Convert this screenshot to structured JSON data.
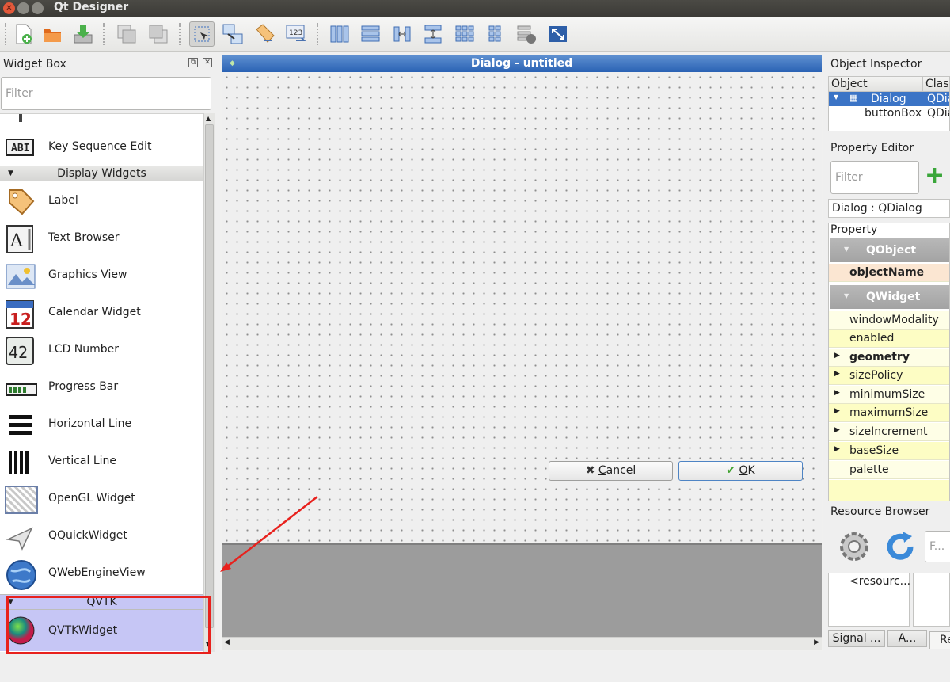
{
  "window": {
    "title": "Qt Designer"
  },
  "toolbar": {
    "icons": [
      "new-form",
      "open-form",
      "save-form",
      "send-to-back",
      "bring-to-front",
      "edit-widgets",
      "edit-signals-slots",
      "edit-buddies",
      "edit-tab-order",
      "layout-horizontal",
      "layout-vertical",
      "layout-splitter-h",
      "layout-splitter-v",
      "layout-grid",
      "layout-form",
      "break-layout",
      "adjust-size"
    ],
    "active": "edit-widgets"
  },
  "widget_box": {
    "title": "Widget Box",
    "filter_placeholder": "Filter",
    "items_top": [
      {
        "label": "Key Sequence Edit",
        "icon": "key-sequence-edit-icon"
      }
    ],
    "categories": [
      {
        "label": "Display Widgets",
        "items": [
          {
            "label": "Label",
            "icon": "label-icon"
          },
          {
            "label": "Text Browser",
            "icon": "text-browser-icon"
          },
          {
            "label": "Graphics View",
            "icon": "graphics-view-icon"
          },
          {
            "label": "Calendar Widget",
            "icon": "calendar-icon"
          },
          {
            "label": "LCD Number",
            "icon": "lcd-number-icon"
          },
          {
            "label": "Progress Bar",
            "icon": "progress-bar-icon"
          },
          {
            "label": "Horizontal Line",
            "icon": "horizontal-line-icon"
          },
          {
            "label": "Vertical Line",
            "icon": "vertical-line-icon"
          },
          {
            "label": "OpenGL Widget",
            "icon": "opengl-widget-icon"
          },
          {
            "label": "QQuickWidget",
            "icon": "qquickwidget-icon"
          },
          {
            "label": "QWebEngineView",
            "icon": "qwebengineview-icon"
          }
        ]
      },
      {
        "label": "QVTK",
        "items": [
          {
            "label": "QVTKWidget",
            "icon": "qvtkwidget-icon"
          }
        ]
      }
    ],
    "calendar_day": "12",
    "lcd_digits": "42",
    "text_browser_glyph": "A"
  },
  "form": {
    "title": "Dialog - untitled",
    "cancel_prefix": "C",
    "cancel_rest": "ancel",
    "ok_prefix": "O",
    "ok_rest": "K"
  },
  "object_inspector": {
    "title": "Object Inspector",
    "columns": [
      "Object",
      "Class"
    ],
    "rows": [
      {
        "object": "Dialog",
        "class": "QDialog",
        "selected": true
      },
      {
        "object": "buttonBox",
        "class": "QDialogButtonBox",
        "selected": false
      }
    ]
  },
  "property_editor": {
    "title": "Property Editor",
    "filter_placeholder": "Filter",
    "context": "Dialog : QDialog",
    "column": "Property",
    "groups": [
      {
        "label": "QObject",
        "rows": [
          {
            "name": "objectName",
            "bold": true,
            "expandable": false
          }
        ]
      },
      {
        "label": "QWidget",
        "rows": [
          {
            "name": "windowModality",
            "bold": false,
            "expandable": false
          },
          {
            "name": "enabled",
            "bold": false,
            "expandable": false
          },
          {
            "name": "geometry",
            "bold": true,
            "expandable": true
          },
          {
            "name": "sizePolicy",
            "bold": false,
            "expandable": true
          },
          {
            "name": "minimumSize",
            "bold": false,
            "expandable": true
          },
          {
            "name": "maximumSize",
            "bold": false,
            "expandable": true
          },
          {
            "name": "sizeIncrement",
            "bold": false,
            "expandable": true
          },
          {
            "name": "baseSize",
            "bold": false,
            "expandable": true
          },
          {
            "name": "palette",
            "bold": false,
            "expandable": false
          }
        ]
      }
    ]
  },
  "resource_browser": {
    "title": "Resource Browser",
    "filter_placeholder": "F...",
    "root": "<resourc...",
    "tabs": [
      "Signal ...",
      "A...",
      "Re"
    ]
  },
  "colors": {
    "selection": "#c6c6f5",
    "highlight_red": "#e8211d",
    "title_blue": "#3c74c2"
  }
}
